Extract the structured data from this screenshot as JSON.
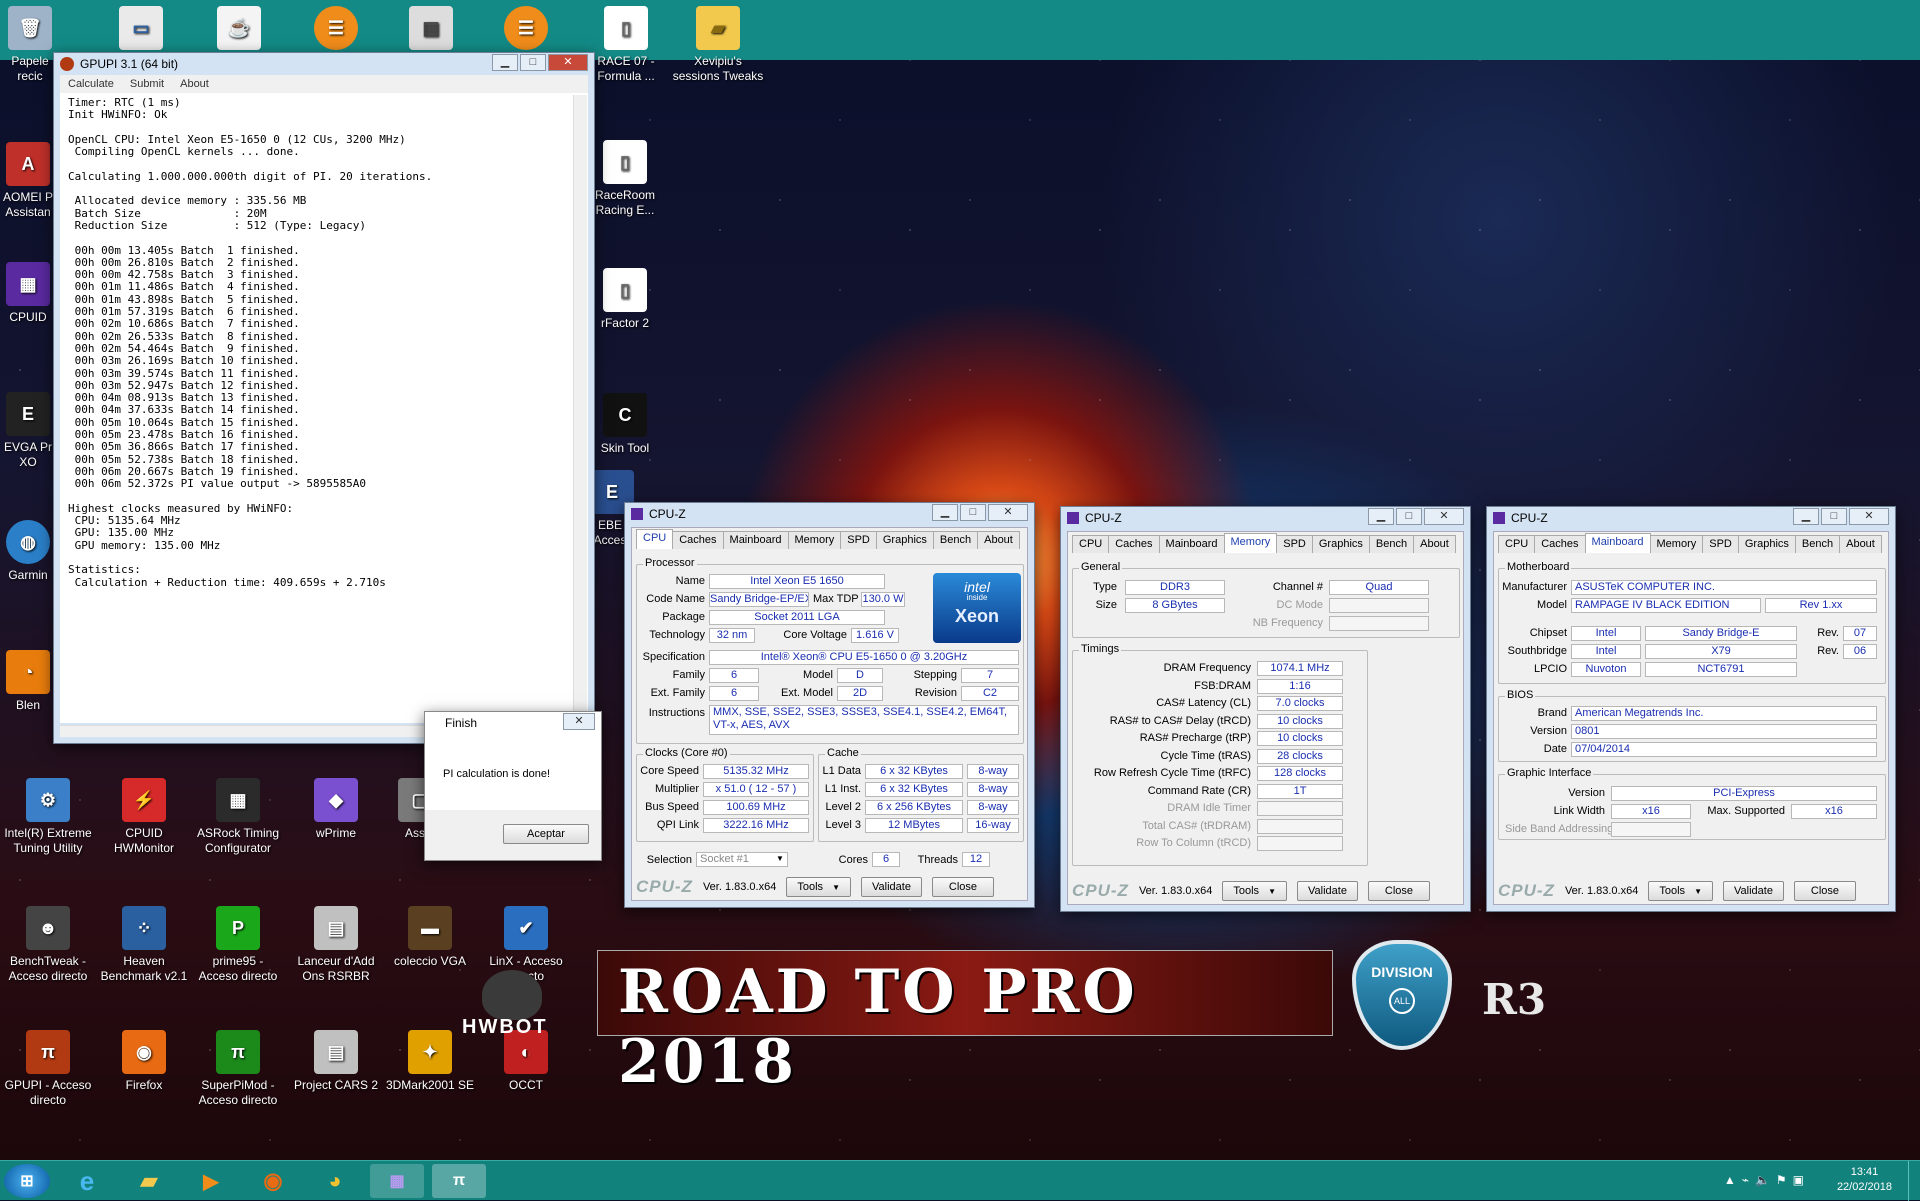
{
  "desktop": {
    "top_icons": [
      {
        "label": "Papele recic"
      },
      {
        "label": ""
      },
      {
        "label": ""
      },
      {
        "label": ""
      },
      {
        "label": ""
      },
      {
        "label": ""
      },
      {
        "label": "RACE 07 - Formula ..."
      },
      {
        "label": "Xevipiu's sessions Tweaks"
      }
    ],
    "left_icons": [
      {
        "label": "AOMEI P Assistan"
      },
      {
        "label": "CPUID"
      },
      {
        "label": "EVGA Pr XO"
      },
      {
        "label": "Garmin"
      },
      {
        "label": "Blen"
      }
    ],
    "mid_icons": [
      {
        "label": "RaceRoom Racing E..."
      },
      {
        "label": "rFactor 2"
      },
      {
        "label": "Skin Tool"
      },
      {
        "label": "EBE Acces"
      }
    ],
    "grid_icons": [
      {
        "label": "Intel(R) Extreme Tuning Utility",
        "color": "#3a7fc8",
        "glyph": "⚙"
      },
      {
        "label": "CPUID HWMonitor",
        "color": "#d62a2a",
        "glyph": "⚡"
      },
      {
        "label": "ASRock Timing Configurator",
        "color": "#2b2b2b",
        "glyph": "▦"
      },
      {
        "label": "wPrime",
        "color": "#7a4fd0",
        "glyph": "◆"
      },
      {
        "label": "Asset",
        "color": "#7a7a7a",
        "glyph": "▢"
      },
      {
        "label": "BenchTweak - Acceso directo",
        "color": "#444",
        "glyph": "☻"
      },
      {
        "label": "Heaven Benchmark v2.1",
        "color": "#2a5fa0",
        "glyph": "⁘"
      },
      {
        "label": "prime95 - Acceso directo",
        "color": "#1aa81a",
        "glyph": "P"
      },
      {
        "label": "Lanceur d'Add Ons RSRBR",
        "color": "#c0c0c0",
        "glyph": "▤"
      },
      {
        "label": "coleccio VGA",
        "color": "#5a4020",
        "glyph": "▬"
      },
      {
        "label": "LinX - Acceso directo",
        "color": "#2a6ec0",
        "glyph": "✔"
      },
      {
        "label": "GPUPI - Acceso directo",
        "color": "#b23a12",
        "glyph": "π"
      },
      {
        "label": "Firefox",
        "color": "#e86a12",
        "glyph": "◉"
      },
      {
        "label": "SuperPiMod - Acceso directo",
        "color": "#1b8a1b",
        "glyph": "π"
      },
      {
        "label": "Project CARS 2",
        "color": "#c0c0c0",
        "glyph": "▤"
      },
      {
        "label": "3DMark2001 SE",
        "color": "#e0a000",
        "glyph": "✦"
      },
      {
        "label": "OCCT",
        "color": "#c02020",
        "glyph": "◐"
      }
    ],
    "hwbot": "HWBOT",
    "banner_text": "ROAD TO PRO 2018",
    "badge_text": "DIVISION",
    "badge_sub": "ALL",
    "r3": "R3"
  },
  "gpupi": {
    "title": "GPUPI 3.1 (64 bit)",
    "menu": [
      "Calculate",
      "Submit",
      "About"
    ],
    "lines": [
      "Timer: RTC (1 ms)",
      "Init HWiNFO: Ok",
      "",
      "OpenCL CPU: Intel Xeon E5-1650 0 (12 CUs, 3200 MHz)",
      " Compiling OpenCL kernels ... done.",
      "",
      "Calculating 1.000.000.000th digit of PI. 20 iterations.",
      "",
      " Allocated device memory : 335.56 MB",
      " Batch Size              : 20M",
      " Reduction Size          : 512 (Type: Legacy)",
      "",
      " 00h 00m 13.405s Batch  1 finished.",
      " 00h 00m 26.810s Batch  2 finished.",
      " 00h 00m 42.758s Batch  3 finished.",
      " 00h 01m 11.486s Batch  4 finished.",
      " 00h 01m 43.898s Batch  5 finished.",
      " 00h 01m 57.319s Batch  6 finished.",
      " 00h 02m 10.686s Batch  7 finished.",
      " 00h 02m 26.533s Batch  8 finished.",
      " 00h 02m 54.464s Batch  9 finished.",
      " 00h 03m 26.169s Batch 10 finished.",
      " 00h 03m 39.574s Batch 11 finished.",
      " 00h 03m 52.947s Batch 12 finished.",
      " 00h 04m 08.913s Batch 13 finished.",
      " 00h 04m 37.633s Batch 14 finished.",
      " 00h 05m 10.064s Batch 15 finished.",
      " 00h 05m 23.478s Batch 16 finished.",
      " 00h 05m 36.866s Batch 17 finished.",
      " 00h 05m 52.738s Batch 18 finished.",
      " 00h 06m 20.667s Batch 19 finished.",
      " 00h 06m 52.372s PI value output -> 5895585A0",
      "",
      "Highest clocks measured by HWiNFO:",
      " CPU: 5135.64 MHz",
      " GPU: 135.00 MHz",
      " GPU memory: 135.00 MHz",
      "",
      "Statistics:",
      " Calculation + Reduction time: 409.659s + 2.710s"
    ]
  },
  "finish": {
    "title": "Finish",
    "message": "PI calculation is done!",
    "button": "Aceptar"
  },
  "cpuz_common": {
    "title": "CPU-Z",
    "tabs": [
      "CPU",
      "Caches",
      "Mainboard",
      "Memory",
      "SPD",
      "Graphics",
      "Bench",
      "About"
    ],
    "logo": "CPU-Z",
    "version": "Ver. 1.83.0.x64",
    "tools": "Tools",
    "validate": "Validate",
    "close": "Close"
  },
  "cpu": {
    "processor_group": "Processor",
    "name_lbl": "Name",
    "name": "Intel Xeon E5 1650",
    "codename_lbl": "Code Name",
    "codename": "Sandy Bridge-EP/EX",
    "maxtdp_lbl": "Max TDP",
    "maxtdp": "130.0 W",
    "package_lbl": "Package",
    "package": "Socket 2011 LGA",
    "tech_lbl": "Technology",
    "tech": "32 nm",
    "corev_lbl": "Core Voltage",
    "corev": "1.616 V",
    "spec_lbl": "Specification",
    "spec": "Intel® Xeon® CPU E5-1650 0 @ 3.20GHz",
    "family_lbl": "Family",
    "family": "6",
    "model_lbl": "Model",
    "model": "D",
    "stepping_lbl": "Stepping",
    "stepping": "7",
    "extfamily_lbl": "Ext. Family",
    "extfamily": "6",
    "extmodel_lbl": "Ext. Model",
    "extmodel": "2D",
    "revision_lbl": "Revision",
    "revision": "C2",
    "instr_lbl": "Instructions",
    "instr": "MMX, SSE, SSE2, SSE3, SSSE3, SSE4.1, SSE4.2, EM64T, VT-x, AES, AVX",
    "intel_logo_top": "intel",
    "intel_logo_inside": "inside",
    "intel_logo_brand": "Xeon",
    "clocks_group": "Clocks (Core #0)",
    "corespeed_lbl": "Core Speed",
    "corespeed": "5135.32 MHz",
    "multiplier_lbl": "Multiplier",
    "multiplier": "x 51.0 ( 12 - 57 )",
    "busspeed_lbl": "Bus Speed",
    "busspeed": "100.69 MHz",
    "qpi_lbl": "QPI Link",
    "qpi": "3222.16 MHz",
    "cache_group": "Cache",
    "l1d_lbl": "L1 Data",
    "l1d": "6 x 32 KBytes",
    "l1d_way": "8-way",
    "l1i_lbl": "L1 Inst.",
    "l1i": "6 x 32 KBytes",
    "l1i_way": "8-way",
    "l2_lbl": "Level 2",
    "l2": "6 x 256 KBytes",
    "l2_way": "8-way",
    "l3_lbl": "Level 3",
    "l3": "12 MBytes",
    "l3_way": "16-way",
    "selection_lbl": "Selection",
    "selection": "Socket #1",
    "cores_lbl": "Cores",
    "cores": "6",
    "threads_lbl": "Threads",
    "threads": "12"
  },
  "mem": {
    "general_group": "General",
    "type_lbl": "Type",
    "type": "DDR3",
    "channel_lbl": "Channel #",
    "channel": "Quad",
    "size_lbl": "Size",
    "size": "8 GBytes",
    "dcmode_lbl": "DC Mode",
    "nbfreq_lbl": "NB Frequency",
    "timings_group": "Timings",
    "rows": [
      {
        "label": "DRAM Frequency",
        "value": "1074.1 MHz"
      },
      {
        "label": "FSB:DRAM",
        "value": "1:16"
      },
      {
        "label": "CAS# Latency (CL)",
        "value": "7.0 clocks"
      },
      {
        "label": "RAS# to CAS# Delay (tRCD)",
        "value": "10 clocks"
      },
      {
        "label": "RAS# Precharge (tRP)",
        "value": "10 clocks"
      },
      {
        "label": "Cycle Time (tRAS)",
        "value": "28 clocks"
      },
      {
        "label": "Row Refresh Cycle Time (tRFC)",
        "value": "128 clocks"
      },
      {
        "label": "Command Rate (CR)",
        "value": "1T"
      },
      {
        "label": "DRAM Idle Timer",
        "value": ""
      },
      {
        "label": "Total CAS# (tRDRAM)",
        "value": ""
      },
      {
        "label": "Row To Column (tRCD)",
        "value": ""
      }
    ]
  },
  "mb": {
    "mb_group": "Motherboard",
    "manufacturer_lbl": "Manufacturer",
    "manufacturer": "ASUSTeK COMPUTER INC.",
    "model_lbl": "Model",
    "model": "RAMPAGE IV BLACK EDITION",
    "model_rev": "Rev 1.xx",
    "chipset_lbl": "Chipset",
    "chipset_vendor": "Intel",
    "chipset": "Sandy Bridge-E",
    "chipset_rev_lbl": "Rev.",
    "chipset_rev": "07",
    "sb_lbl": "Southbridge",
    "sb_vendor": "Intel",
    "sb": "X79",
    "sb_rev_lbl": "Rev.",
    "sb_rev": "06",
    "lpcio_lbl": "LPCIO",
    "lpcio_vendor": "Nuvoton",
    "lpcio": "NCT6791",
    "bios_group": "BIOS",
    "brand_lbl": "Brand",
    "brand": "American Megatrends Inc.",
    "version_lbl": "Version",
    "version": "0801",
    "date_lbl": "Date",
    "date": "07/04/2014",
    "gi_group": "Graphic Interface",
    "giver_lbl": "Version",
    "giver": "PCI-Express",
    "linkwidth_lbl": "Link Width",
    "linkwidth": "x16",
    "maxsup_lbl": "Max. Supported",
    "maxsup": "x16",
    "sideband_lbl": "Side Band Addressing"
  },
  "taskbar": {
    "time": "13:41",
    "date": "22/02/2018"
  }
}
